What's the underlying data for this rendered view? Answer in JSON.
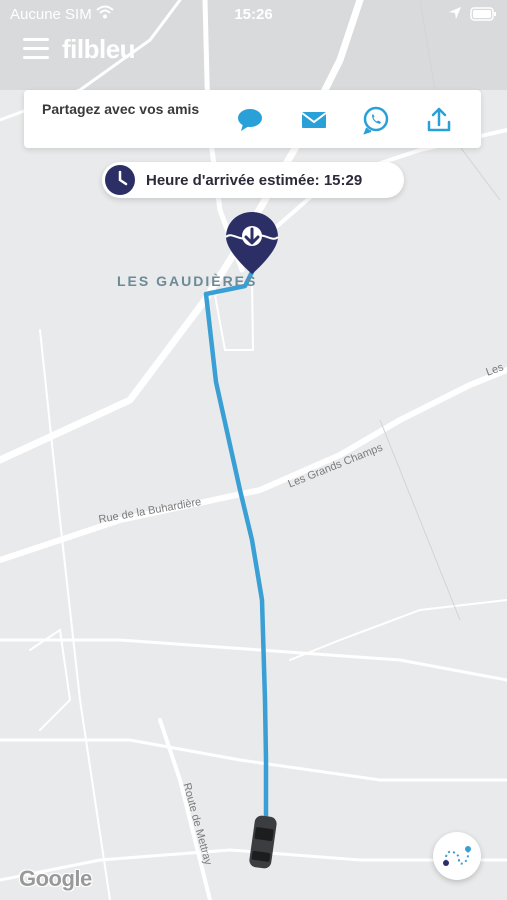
{
  "status_bar": {
    "carrier": "Aucune SIM",
    "time": "15:26"
  },
  "app": {
    "brand": "filbleu"
  },
  "share": {
    "title": "Partagez avec vos amis",
    "icons": [
      "chat-bubble-icon",
      "mail-icon",
      "whatsapp-icon",
      "upload-share-icon"
    ]
  },
  "eta": {
    "text": "Heure d'arrivée estimée: 15:29"
  },
  "map": {
    "place": "LES GAUDIÈRES",
    "streets": {
      "buhardiere": "Rue de la Buhardière",
      "grands_champs": "Les Grands Champs",
      "mettray": "Route de Mettray",
      "les": "Les"
    },
    "attribution": "Google"
  },
  "colors": {
    "route": "#3a9fd4",
    "brand_navy": "#2b2f66",
    "map_bg": "#e9eaeb"
  }
}
